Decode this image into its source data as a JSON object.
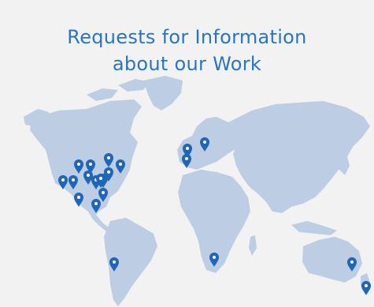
{
  "title": {
    "line1": "Requests for Information",
    "line2": "about our Work"
  },
  "colors": {
    "background": "#f2f2f2",
    "title": "#2a74c4",
    "land": "#bdcde3",
    "marker": "#1f66b8",
    "marker_dot": "#ffffff"
  },
  "markers": [
    {
      "region": "north-america"
    },
    {
      "region": "north-america"
    },
    {
      "region": "north-america"
    },
    {
      "region": "north-america"
    },
    {
      "region": "north-america"
    },
    {
      "region": "north-america"
    },
    {
      "region": "north-america"
    },
    {
      "region": "north-america"
    },
    {
      "region": "north-america"
    },
    {
      "region": "north-america"
    },
    {
      "region": "north-america"
    },
    {
      "region": "north-america"
    },
    {
      "region": "north-america"
    },
    {
      "region": "north-america"
    },
    {
      "region": "europe"
    },
    {
      "region": "europe"
    },
    {
      "region": "europe"
    },
    {
      "region": "south-america"
    },
    {
      "region": "africa"
    },
    {
      "region": "australia"
    },
    {
      "region": "new-zealand"
    }
  ]
}
